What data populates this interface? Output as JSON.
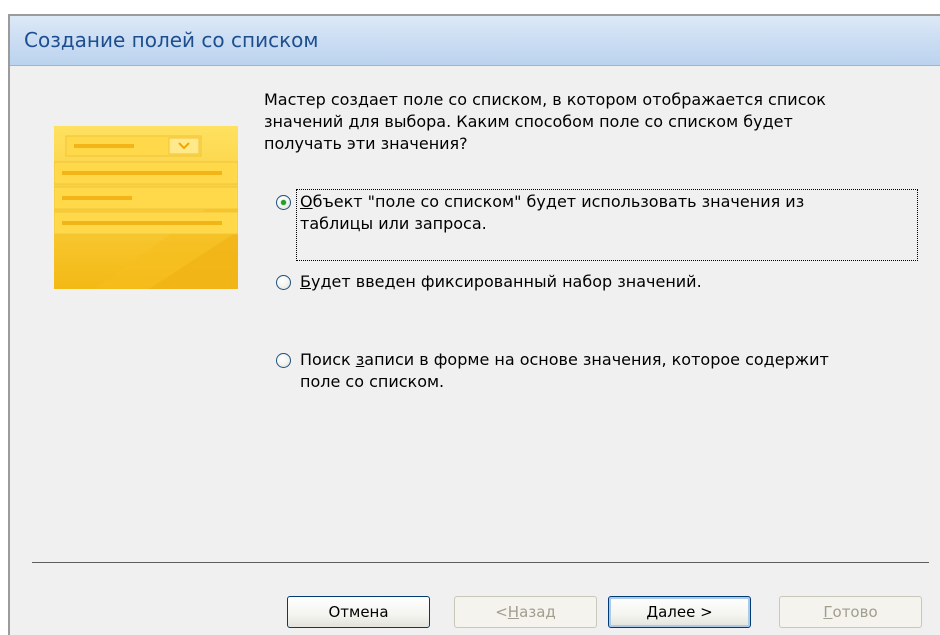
{
  "window": {
    "title": "Создание полей со списком"
  },
  "intro_text": "Мастер создает поле со списком, в котором отображается список\nзначений для выбора.  Каким способом поле со списком будет\nполучать эти значения?",
  "options": [
    {
      "mnemonic": "О",
      "rest": "бъект \"поле со списком\" будет использовать значения из\nтаблицы или запроса.",
      "selected": true
    },
    {
      "mnemonic": "Б",
      "rest": "удет введен фиксированный набор значений.",
      "selected": false
    },
    {
      "prefix": "Поиск ",
      "mnemonic": "з",
      "rest": "аписи в форме на основе значения, которое содержит\nполе со списком.",
      "selected": false
    }
  ],
  "buttons": {
    "cancel": {
      "label": "Отмена"
    },
    "back": {
      "prefix": "< ",
      "mnemonic": "Н",
      "rest": "азад"
    },
    "next": {
      "mnemonic": "Д",
      "rest": "алее >"
    },
    "finish": {
      "mnemonic": "Г",
      "rest": "отово"
    }
  },
  "colors": {
    "title_text": "#1d4f8f",
    "title_bar": "#c9dcf2",
    "illustration": "#f7c62f",
    "radio_selected": "#21a121"
  }
}
